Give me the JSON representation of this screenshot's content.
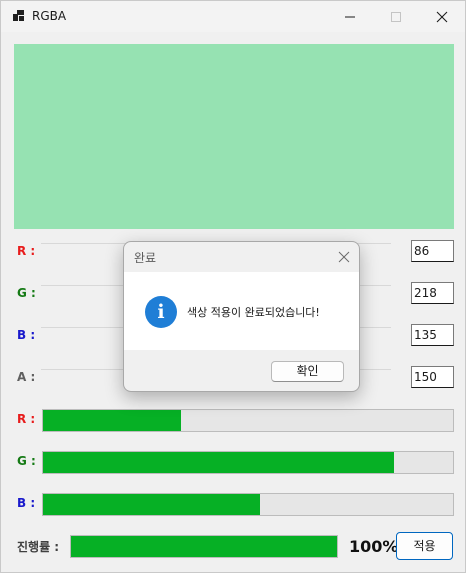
{
  "window": {
    "title": "RGBA",
    "app_icon": "app-icon",
    "controls": {
      "minimize": "minimize-icon",
      "maximize": "maximize-icon",
      "close": "close-icon"
    }
  },
  "preview": {
    "color": "#96e2b2"
  },
  "channels": [
    {
      "label": "R :",
      "value": "86",
      "color": "#e81c1c"
    },
    {
      "label": "G :",
      "value": "218",
      "color": "#157a15"
    },
    {
      "label": "B :",
      "value": "135",
      "color": "#1a1acc"
    },
    {
      "label": "A :",
      "value": "150",
      "color": "#5f5f5f"
    }
  ],
  "bars": [
    {
      "label": "R :",
      "level": 0.337
    },
    {
      "label": "G :",
      "level": 0.855
    },
    {
      "label": "B :",
      "level": 0.529
    }
  ],
  "progress": {
    "label": "진행률 :",
    "level": 1.0,
    "percent_text": "100%",
    "apply_label": "적용"
  },
  "dialog": {
    "title": "완료",
    "message": "색상 적용이 완료되었습니다!",
    "icon": "info-icon",
    "ok_label": "확인"
  },
  "colors": {
    "fill_green": "#06b025",
    "accent": "#0067c0"
  }
}
